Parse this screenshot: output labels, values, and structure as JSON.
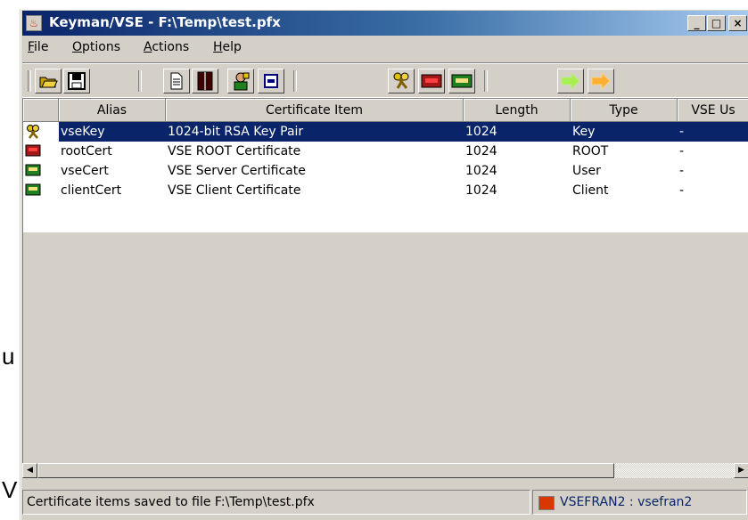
{
  "window": {
    "title": "Keyman/VSE - F:\\Temp\\test.pfx",
    "minimize": "_",
    "maximize": "□",
    "close": "×"
  },
  "menu": [
    {
      "label": "File"
    },
    {
      "label": "Options"
    },
    {
      "label": "Actions"
    },
    {
      "label": "Help"
    }
  ],
  "toolbar": {
    "buttons": [
      "open-icon",
      "save-icon",
      "document-icon",
      "book-icon",
      "person-key-icon",
      "certificate-view-icon",
      "key-pair-icon",
      "root-cert-icon",
      "user-cert-icon",
      "arrow-right-green-icon",
      "arrow-right-orange-icon"
    ]
  },
  "list": {
    "columns": [
      "Alias",
      "Certificate Item",
      "Length",
      "Type",
      "VSE Us"
    ],
    "rows": [
      {
        "icon": "key-pair-icon",
        "alias": "vseKey",
        "item": "1024-bit RSA Key Pair",
        "length": "1024",
        "type": "Key",
        "vse": "-",
        "selected": true
      },
      {
        "icon": "root-cert-icon",
        "alias": "rootCert",
        "item": "VSE ROOT Certificate",
        "length": "1024",
        "type": "ROOT",
        "vse": "-"
      },
      {
        "icon": "user-cert-icon",
        "alias": "vseCert",
        "item": "VSE Server Certificate",
        "length": "1024",
        "type": "User",
        "vse": "-"
      },
      {
        "icon": "user-cert-icon",
        "alias": "clientCert",
        "item": "VSE Client Certificate",
        "length": "1024",
        "type": "Client",
        "vse": "-"
      }
    ]
  },
  "status": {
    "message": "Certificate items saved to file F:\\Temp\\test.pfx",
    "connection": "VSEFRAN2 : vsefran2",
    "connection_color": "#d83800"
  },
  "background_fragments": {
    "frag1": "u",
    "frag2": "V"
  }
}
